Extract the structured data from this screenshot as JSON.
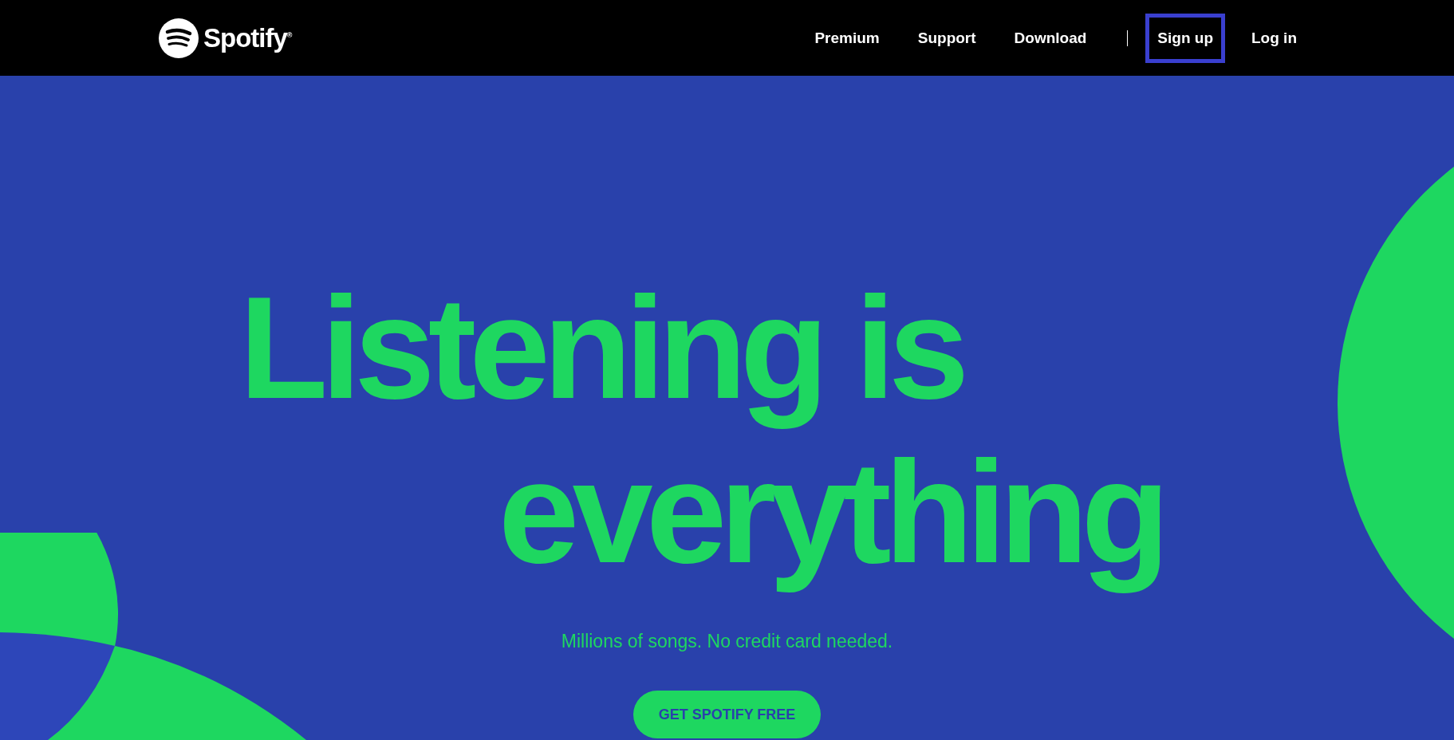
{
  "header": {
    "logo": {
      "text": "Spotify$^{®}$"
    },
    "nav": [
      {
        "label": "Premium",
        "focused": false
      },
      {
        "label": "Support",
        "focused": false
      },
      {
        "label": "Download",
        "focused": false
      },
      {
        "kind": "divider"
      },
      {
        "label": "Sign up",
        "focused": true
      },
      {
        "label": "Log in",
        "focused": false
      }
    ]
  },
  "hero": {
    "headline": [
      "Listening is",
      "everything"
    ],
    "subtitle": "Millions of songs. No credit card needed.",
    "cta": "GET SPOTIFY FREE"
  }
}
